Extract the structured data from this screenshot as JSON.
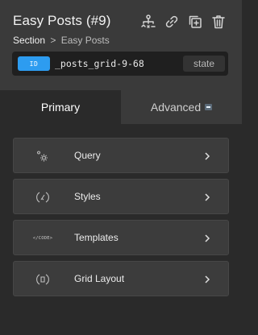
{
  "header": {
    "title": "Easy Posts (#9)",
    "breadcrumb": {
      "root": "Section",
      "separator": ">",
      "leaf": "Easy Posts"
    },
    "icons": [
      "structure-icon",
      "link-icon",
      "duplicate-icon",
      "delete-icon"
    ]
  },
  "id_bar": {
    "badge": "ID",
    "value": "_posts_grid-9-68",
    "state_label": "state"
  },
  "tabs": [
    {
      "label": "Primary",
      "active": true
    },
    {
      "label": "Advanced",
      "active": false
    }
  ],
  "items": [
    {
      "label": "Query",
      "icon": "query-gear-icon"
    },
    {
      "label": "Styles",
      "icon": "styles-icon"
    },
    {
      "label": "Templates",
      "icon": "code-icon",
      "icon_text": "</CODE>"
    },
    {
      "label": "Grid Layout",
      "icon": "grid-layout-icon"
    }
  ],
  "colors": {
    "accent": "#2d9cf0",
    "panel": "#3a3a3a",
    "background": "#2a2a2a"
  }
}
